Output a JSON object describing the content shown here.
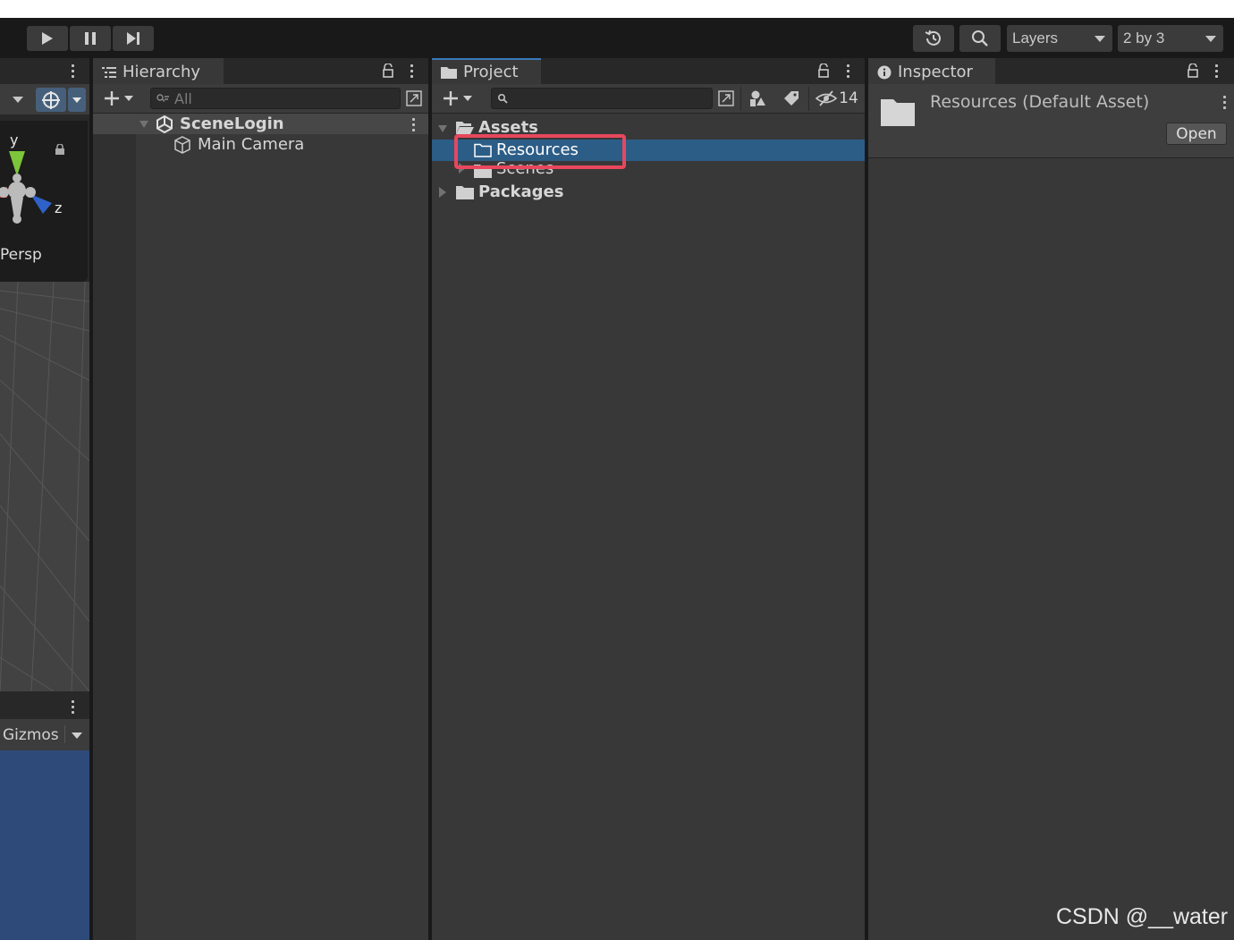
{
  "toolbar": {
    "play_icon": "play-icon",
    "pause_icon": "pause-icon",
    "step_icon": "step-icon",
    "history_icon": "history-icon",
    "search_icon": "search-icon",
    "layers_label": "Layers",
    "layout_label": "2 by 3"
  },
  "scene": {
    "axis_y": "y",
    "axis_z": "z",
    "persp_label": "Persp",
    "gizmos_label": "Gizmos"
  },
  "hierarchy": {
    "tab_label": "Hierarchy",
    "search_placeholder": "All",
    "scene_name": "SceneLogin",
    "items": [
      {
        "label": "Main Camera",
        "icon": "gameobject-cube-icon"
      }
    ]
  },
  "project": {
    "tab_label": "Project",
    "hidden_count": "14",
    "tree": {
      "assets_label": "Assets",
      "resources_label": "Resources",
      "scenes_label": "Scenes",
      "packages_label": "Packages"
    }
  },
  "inspector": {
    "tab_label": "Inspector",
    "asset_title": "Resources (Default Asset)",
    "open_button": "Open"
  },
  "watermark": "CSDN @__water",
  "colors": {
    "selection": "#2c5d87",
    "highlight_box": "#e8475d",
    "active_tab": "#3a79bb"
  }
}
